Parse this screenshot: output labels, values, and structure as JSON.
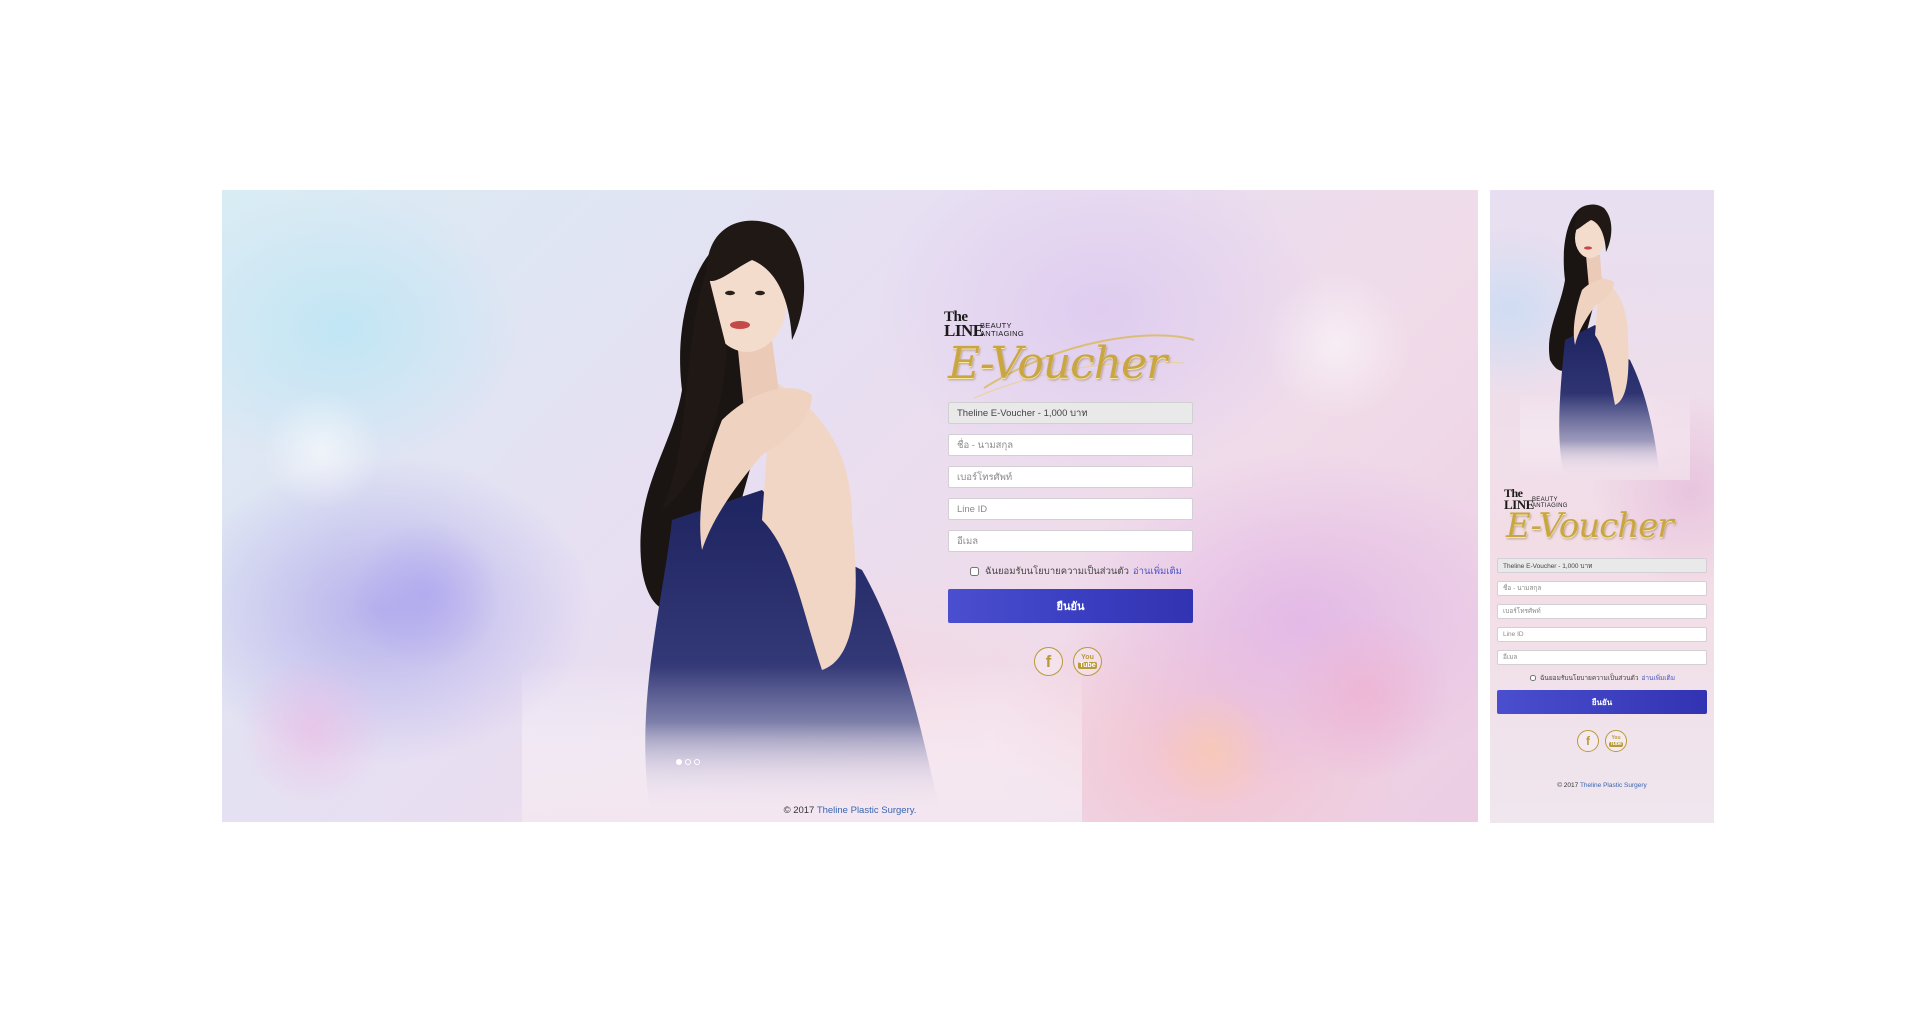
{
  "desktop": {
    "brand": {
      "the": "The",
      "line": "LINE",
      "beauty": "BEAUTY",
      "antiaging": "ANTIAGING",
      "title": "E-Voucher"
    },
    "form": {
      "voucher_value": "Theline E-Voucher - 1,000 บาท",
      "name_placeholder": "ชื่อ - นามสกุล",
      "phone_placeholder": "เบอร์โทรศัพท์",
      "lineid_placeholder": "Line ID",
      "email_placeholder": "อีเมล",
      "consent_text": "ฉันยอมรับนโยบายความเป็นส่วนตัว",
      "consent_link": "อ่านเพิ่มเติม",
      "submit_label": "ยืนยัน"
    },
    "social": {
      "facebook": "f",
      "youtube_top": "You",
      "youtube_bottom": "Tube"
    },
    "carousel": {
      "count": 3,
      "active": 1
    },
    "footer": {
      "copyright": "© 2017",
      "link": "Theline Plastic Surgery."
    }
  },
  "mobile": {
    "brand": {
      "the": "The",
      "line": "LINE",
      "beauty": "BEAUTY",
      "antiaging": "ANTIAGING",
      "title": "E-Voucher"
    },
    "form": {
      "voucher_value": "Theline E-Voucher - 1,000 บาท",
      "name_placeholder": "ชื่อ - นามสกุล",
      "phone_placeholder": "เบอร์โทรศัพท์",
      "lineid_placeholder": "Line ID",
      "email_placeholder": "อีเมล",
      "consent_text": "ฉันยอมรับนโยบายความเป็นส่วนตัว",
      "consent_link": "อ่านเพิ่มเติม",
      "submit_label": "ยืนยัน"
    },
    "social": {
      "facebook": "f",
      "youtube_top": "You",
      "youtube_bottom": "Tube"
    },
    "footer": {
      "copyright": "© 2017",
      "link": "Theline Plastic Surgery"
    }
  },
  "colors": {
    "accent": "#3b3fc2",
    "gold": "#c9a642",
    "link": "#3a66b0"
  },
  "icons": [
    "facebook-icon",
    "youtube-icon"
  ]
}
